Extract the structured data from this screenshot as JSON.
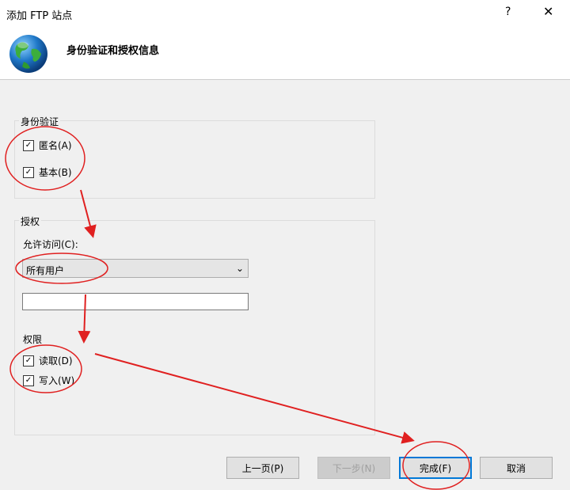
{
  "window": {
    "title": "添加 FTP 站点",
    "help_glyph": "?",
    "close_glyph": "✕"
  },
  "header": {
    "title": "身份验证和授权信息",
    "icon": "globe-icon"
  },
  "auth": {
    "legend": "身份验证",
    "anonymous": {
      "label": "匿名(A)",
      "checked": true
    },
    "basic": {
      "label": "基本(B)",
      "checked": true
    }
  },
  "authorization": {
    "legend": "授权",
    "allow_access_label": "允许访问(C):",
    "allow_access_value": "所有用户",
    "extra_value": "",
    "permissions_legend": "权限",
    "read": {
      "label": "读取(D)",
      "checked": true
    },
    "write": {
      "label": "写入(W)",
      "checked": true
    }
  },
  "buttons": {
    "prev": "上一页(P)",
    "next": "下一步(N)",
    "finish": "完成(F)",
    "cancel": "取消"
  },
  "annotation_color": "#e02020",
  "check_glyph": "✓"
}
